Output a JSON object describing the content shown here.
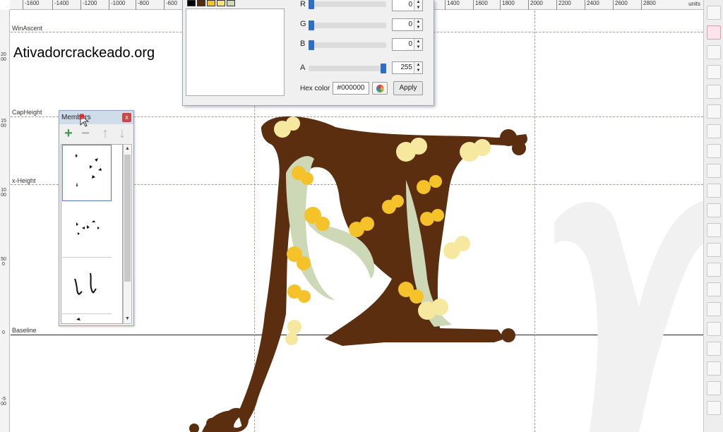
{
  "watermark": "Ativadorcrackeado.org",
  "ruler": {
    "ticks": [
      "-1600",
      "-1400",
      "-1200",
      "-1000",
      "-800",
      "-600",
      "1400",
      "1600",
      "1800",
      "2000",
      "2200",
      "2400",
      "2600",
      "2800"
    ],
    "units": "units",
    "vertical_ticks": [
      "2000",
      "1500",
      "1000",
      "500",
      "0",
      "-500"
    ]
  },
  "guides": {
    "win_ascent": "WinAscent",
    "cap_height": "CapHeight",
    "x_height": "x-Height",
    "baseline": "Baseline"
  },
  "color_dialog": {
    "channels": [
      {
        "label": "R",
        "value": "0",
        "level": 0
      },
      {
        "label": "G",
        "value": "0",
        "level": 0
      },
      {
        "label": "B",
        "value": "0",
        "level": 0
      },
      {
        "label": "A",
        "value": "255",
        "level": 1
      }
    ],
    "hex_label": "Hex color",
    "hex_value": "#000000",
    "apply_label": "Apply",
    "swatch_colors": [
      "#000000",
      "#5a2a0c",
      "#f2c12e",
      "#f7e27a",
      "#cfd8b8"
    ]
  },
  "members_panel": {
    "title": "Members",
    "close_label": "x",
    "add_label": "+",
    "remove_label": "−",
    "up_label": "↑",
    "down_label": "↓"
  },
  "colors": {
    "glyph_brown": "#5a2e0e",
    "leaf_yellow": "#f5c22a",
    "leaf_cream": "#f7e8a0",
    "vine_sage": "#cdd8b6"
  }
}
